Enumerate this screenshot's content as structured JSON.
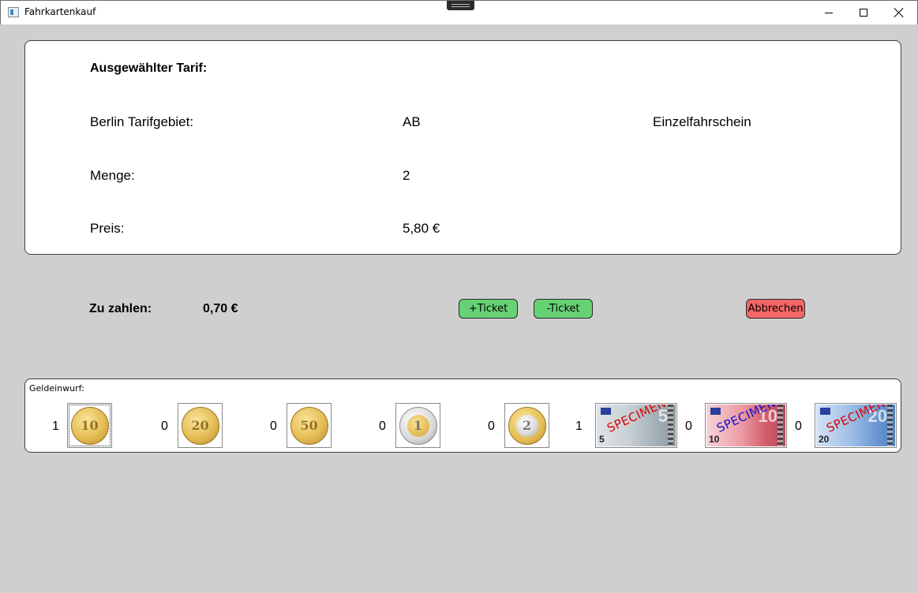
{
  "window": {
    "title": "Fahrkartenkauf",
    "icon": "app-window-icon",
    "controls": [
      "minimize-icon",
      "maximize-icon",
      "close-icon"
    ]
  },
  "tarif": {
    "heading": "Ausgewählter Tarif:",
    "area_label": "Berlin Tarifgebiet:",
    "area_value": "AB",
    "ticket_type": "Einzelfahrschein",
    "quantity_label": "Menge:",
    "quantity_value": "2",
    "price_label": "Preis:",
    "price_value": "5,80 €"
  },
  "payment": {
    "due_label": "Zu zahlen:",
    "due_value": "0,70 €",
    "add_ticket": "+Ticket",
    "remove_ticket": "-Ticket",
    "cancel": "Abbrechen"
  },
  "colors": {
    "ticket_buttons": "#66d275",
    "cancel_button": "#f56666",
    "background": "#d0cfd0"
  },
  "money": {
    "title": "Geldeinwurf:",
    "items": [
      {
        "name": "10-cent-coin",
        "count": "1",
        "face": "10"
      },
      {
        "name": "20-cent-coin",
        "count": "0",
        "face": "20"
      },
      {
        "name": "50-cent-coin",
        "count": "0",
        "face": "50"
      },
      {
        "name": "1-euro-coin",
        "count": "0",
        "face": "1"
      },
      {
        "name": "2-euro-coin",
        "count": "0",
        "face": "2"
      },
      {
        "name": "5-euro-note",
        "count": "1",
        "face": "5",
        "watermark": "SPECIMEN"
      },
      {
        "name": "10-euro-note",
        "count": "0",
        "face": "10",
        "watermark": "SPECIMEN"
      },
      {
        "name": "20-euro-note",
        "count": "0",
        "face": "20",
        "watermark": "SPECIMEN"
      }
    ]
  }
}
